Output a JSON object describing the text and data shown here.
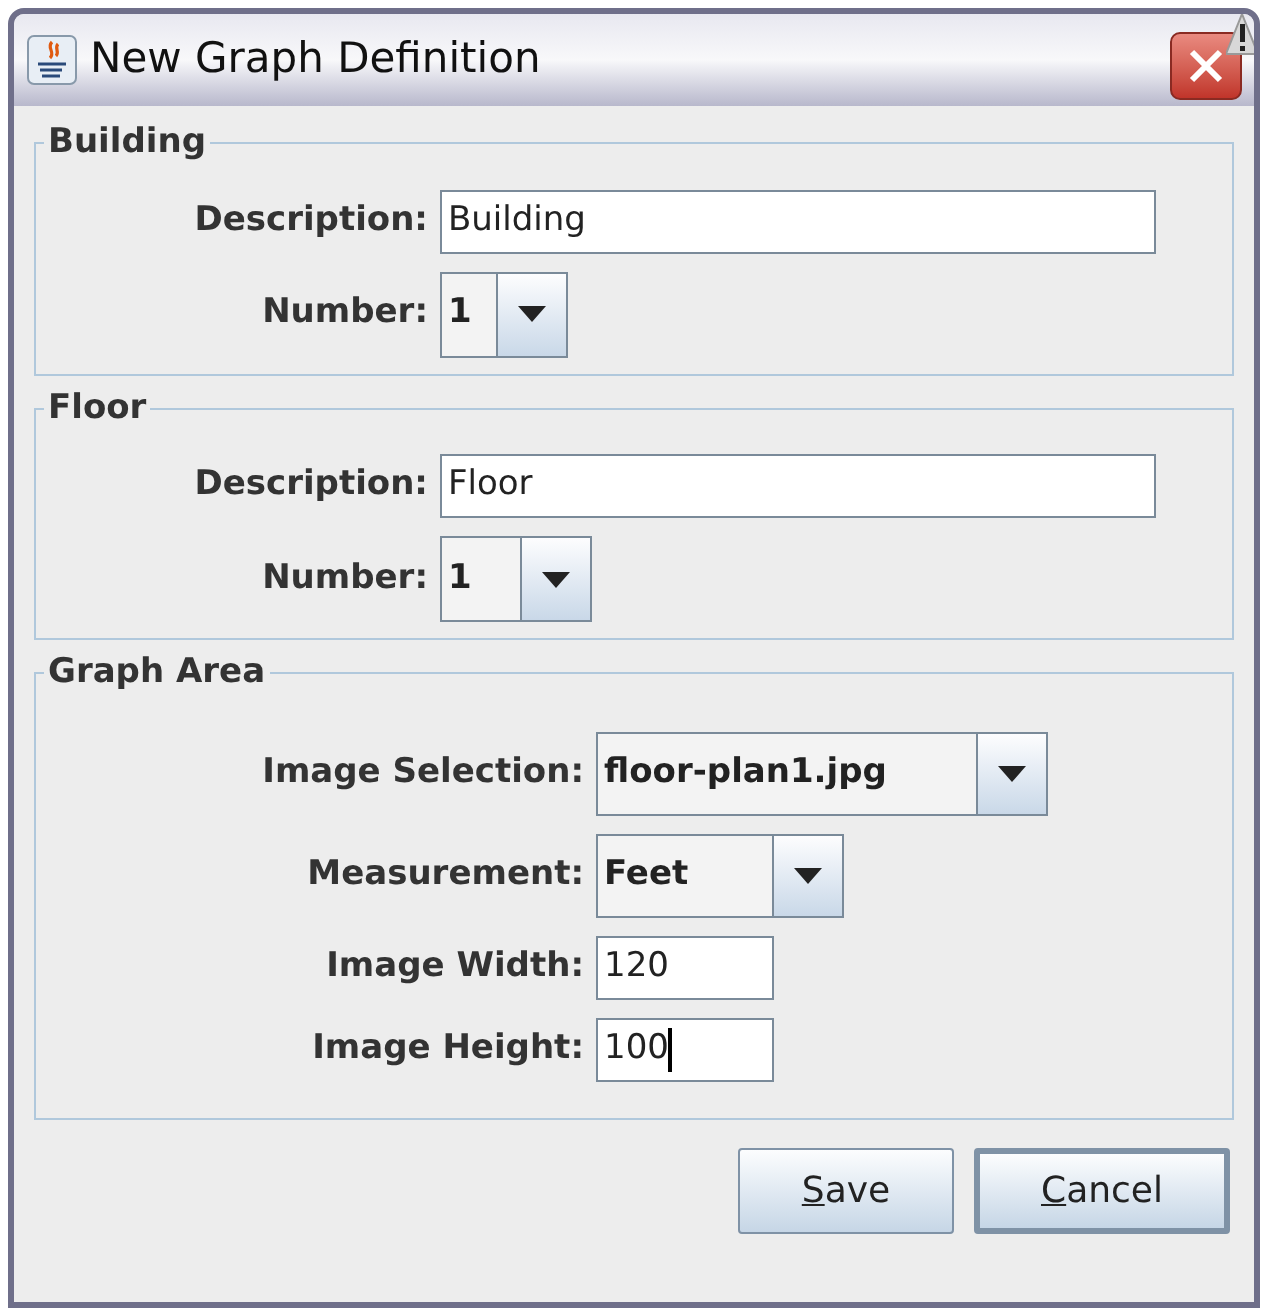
{
  "window": {
    "title": "New Graph Definition"
  },
  "groups": [
    {
      "title": "Building",
      "rows": [
        {
          "kind": "text",
          "label": "Description:",
          "value": "Building",
          "focused": false
        },
        {
          "kind": "combo",
          "label": "Number:",
          "value": "1"
        }
      ]
    },
    {
      "title": "Floor",
      "rows": [
        {
          "kind": "text",
          "label": "Description:",
          "value": "Floor",
          "focused": false
        },
        {
          "kind": "combo",
          "label": "Number:",
          "value": "1"
        }
      ]
    },
    {
      "title": "Graph Area",
      "rows": [
        {
          "kind": "combo",
          "label": "Image Selection:",
          "value": "floor-plan1.jpg"
        },
        {
          "kind": "combo",
          "label": "Measurement:",
          "value": "Feet"
        },
        {
          "kind": "text",
          "label": "Image Width:",
          "value": "120",
          "focused": false
        },
        {
          "kind": "text",
          "label": "Image Height:",
          "value": "100",
          "focused": true
        }
      ]
    }
  ],
  "buttons": [
    {
      "mnemonic": "S",
      "rest": "ave",
      "default": false
    },
    {
      "mnemonic": "C",
      "rest": "ancel",
      "default": true
    }
  ]
}
